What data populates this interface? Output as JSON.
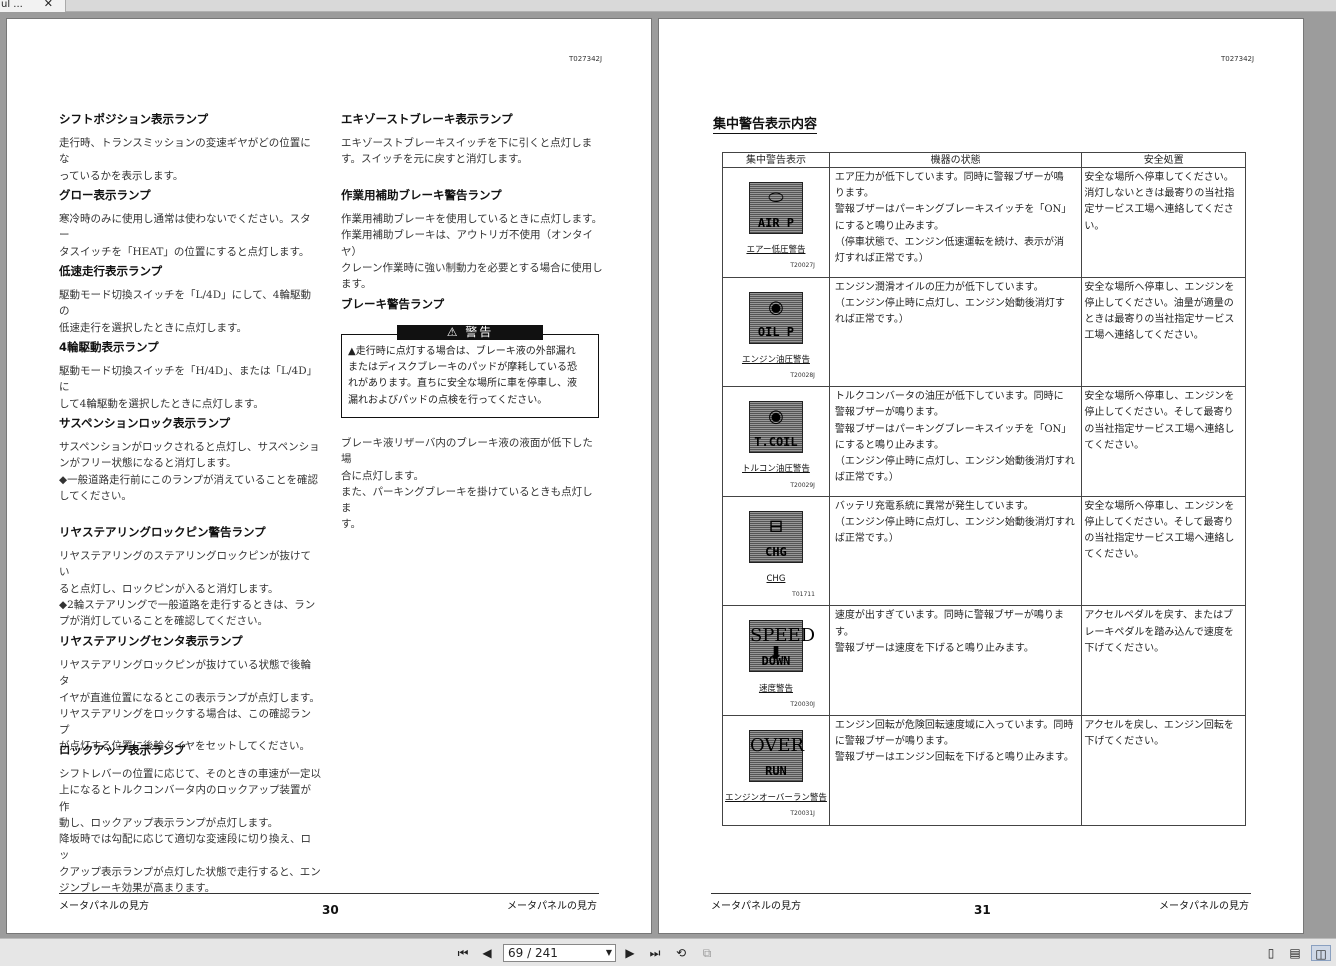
{
  "tab": {
    "title": "ul ...",
    "close": "✕"
  },
  "left_page": {
    "code": "T027342J",
    "col1": [
      {
        "heading": "シフトポジション表示ランプ",
        "lines": [
          "走行時、トランスミッションの変速ギヤがどの位置にな",
          "っているかを表示します。"
        ]
      },
      {
        "heading": "グロー表示ランプ",
        "lines": [
          "寒冷時のみに使用し通常は使わないでください。スター",
          "タスイッチを「HEAT」の位置にすると点灯します。"
        ]
      },
      {
        "heading": "低速走行表示ランプ",
        "lines": [
          "駆動モード切換スイッチを「L/4D」にして、4輪駆動の",
          "低速走行を選択したときに点灯します。"
        ]
      },
      {
        "heading": "4輪駆動表示ランプ",
        "lines": [
          "駆動モード切換スイッチを「H/4D」、または「L/4D」に",
          "して4輪駆動を選択したときに点灯します。"
        ]
      },
      {
        "heading": "サスペンションロック表示ランプ",
        "lines": [
          "サスペンションがロックされると点灯し、サスペンショ",
          "ンがフリー状態になると消灯します。",
          "◆一般道路走行前にこのランプが消えていることを確認",
          "してください。"
        ]
      },
      {
        "heading": "リヤステアリングロックピン警告ランプ",
        "lines": [
          "リヤステアリングのステアリングロックピンが抜けてい",
          "ると点灯し、ロックピンが入ると消灯します。",
          "◆2輪ステアリングで一般道路を走行するときは、ラン",
          "プが消灯していることを確認してください。"
        ]
      },
      {
        "heading": "リヤステアリングセンタ表示ランプ",
        "lines": [
          "リヤステアリングロックピンが抜けている状態で後輪タ",
          "イヤが直進位置になるとこの表示ランプが点灯します。",
          "リヤステアリングをロックする場合は、この確認ランプ",
          "が点灯する位置に後輪タイヤをセットしてください。"
        ]
      },
      {
        "heading": "ロックアップ表示ランプ",
        "lines": [
          "シフトレバーの位置に応じて、そのときの車速が一定以",
          "上になるとトルクコンバータ内のロックアップ装置が作",
          "動し、ロックアップ表示ランプが点灯します。",
          "降坂時では勾配に応じて適切な変速段に切り換え、ロッ",
          "クアップ表示ランプが点灯した状態で走行すると、エン",
          "ジンブレーキ効果が高まります。"
        ]
      }
    ],
    "col2": [
      {
        "heading": "エキゾーストブレーキ表示ランプ",
        "lines": [
          "エキゾーストブレーキスイッチを下に引くと点灯しま",
          "す。スイッチを元に戻すと消灯します。"
        ]
      },
      {
        "heading": "作業用補助ブレーキ警告ランプ",
        "lines": [
          "作業用補助ブレーキを使用しているときに点灯します。",
          "作業用補助ブレーキは、アウトリガ不使用（オンタイヤ）",
          "クレーン作業時に強い制動力を必要とする場合に使用し",
          "ます。"
        ]
      },
      {
        "heading": "ブレーキ警告ランプ",
        "lines": []
      }
    ],
    "warning": {
      "header": "⚠ 警告",
      "lines": [
        "走行時に点灯する場合は、ブレーキ液の外部漏れ",
        "またはディスクブレーキのパッドが摩耗している恐",
        "れがあります。直ちに安全な場所に車を停車し、液",
        "漏れおよびパッドの点検を行ってください。"
      ]
    },
    "after_warning": [
      "ブレーキ液リザーバ内のブレーキ液の液面が低下した場",
      "合に点灯します。",
      "また、パーキングブレーキを掛けているときも点灯しま",
      "す。"
    ],
    "footer_left": "メータパネルの見方",
    "page_number": "30",
    "footer_right": "メータパネルの見方"
  },
  "right_page": {
    "code": "T027342J",
    "title": "集中警告表示内容",
    "table_headers": [
      "集中警告表示",
      "機器の状態",
      "安全処置"
    ],
    "rows": [
      {
        "icon_label": "AIR P",
        "icon_shape": "⬭",
        "name": "エアー低圧警告",
        "code": "T20027J",
        "state": [
          "エア圧力が低下しています。同時に警報ブザーが鳴",
          "ります。",
          "警報ブザーはパーキングブレーキスイッチを「ON」",
          "にすると鳴り止みます。",
          "（停車状態で、エンジン低速運転を続け、表示が消",
          "灯すれば正常です。）"
        ],
        "action": [
          "安全な場所へ停車してください。",
          "消灯しないときは最寄りの当社指",
          "定サービス工場へ連絡してくださ",
          "い。"
        ]
      },
      {
        "icon_label": "OIL P",
        "icon_shape": "◉",
        "name": "エンジン油圧警告",
        "code": "T20028J",
        "state": [
          "エンジン潤滑オイルの圧力が低下しています。",
          "（エンジン停止時に点灯し、エンジン始動後消灯す",
          "れば正常です。）"
        ],
        "action": [
          "安全な場所へ停車し、エンジンを",
          "停止してください。油量が適量の",
          "ときは最寄りの当社指定サービス",
          "工場へ連絡してください。"
        ]
      },
      {
        "icon_label": "T.COIL",
        "icon_shape": "◉",
        "name": "トルコン油圧警告",
        "code": "T20029J",
        "state": [
          "トルクコンバータの油圧が低下しています。同時に",
          "警報ブザーが鳴ります。",
          "警報ブザーはパーキングブレーキスイッチを「ON」",
          "にすると鳴り止みます。",
          "（エンジン停止時に点灯し、エンジン始動後消灯すれ",
          "ば正常です。）"
        ],
        "action": [
          "安全な場所へ停車し、エンジンを",
          "停止してください。そして最寄り",
          "の当社指定サービス工場へ連絡し",
          "てください。"
        ]
      },
      {
        "icon_label": "CHG",
        "icon_shape": "⊟",
        "name": "CHG",
        "code": "T01711",
        "state": [
          "バッテリ充電系統に異常が発生しています。",
          "（エンジン停止時に点灯し、エンジン始動後消灯すれ",
          "ば正常です。）"
        ],
        "action": [
          "安全な場所へ停車し、エンジンを",
          "停止してください。そして最寄り",
          "の当社指定サービス工場へ連絡し",
          "てください。"
        ]
      },
      {
        "icon_label": "DOWN",
        "icon_shape": "SPEED ⬇",
        "name": "速度警告",
        "code": "T20030J",
        "state": [
          "速度が出すぎています。同時に警報ブザーが鳴ります。",
          "警報ブザーは速度を下げると鳴り止みます。"
        ],
        "action": [
          "アクセルペダルを戻す、またはブ",
          "レーキペダルを踏み込んで速度を",
          "下げてください。"
        ]
      },
      {
        "icon_label": "RUN",
        "icon_shape": "OVER",
        "name": "エンジンオーバーラン警告",
        "code": "T20031J",
        "state": [
          "エンジン回転が危険回転速度域に入っています。同時",
          "に警報ブザーが鳴ります。",
          "警報ブザーはエンジン回転を下げると鳴り止みます。"
        ],
        "action": [
          "アクセルを戻し、エンジン回転を",
          "下げてください。"
        ]
      }
    ],
    "footer_left": "メータパネルの見方",
    "page_number": "31",
    "footer_right": "メータパネルの見方"
  },
  "toolbar": {
    "first": "⏮",
    "prev": "◀",
    "page_value": "69 / 241",
    "next": "▶",
    "last": "⏭",
    "rotate_icon": "⟲",
    "copy_icon": "⧉",
    "view_single": "▯",
    "view_continuous": "▤",
    "view_dual": "◫"
  }
}
